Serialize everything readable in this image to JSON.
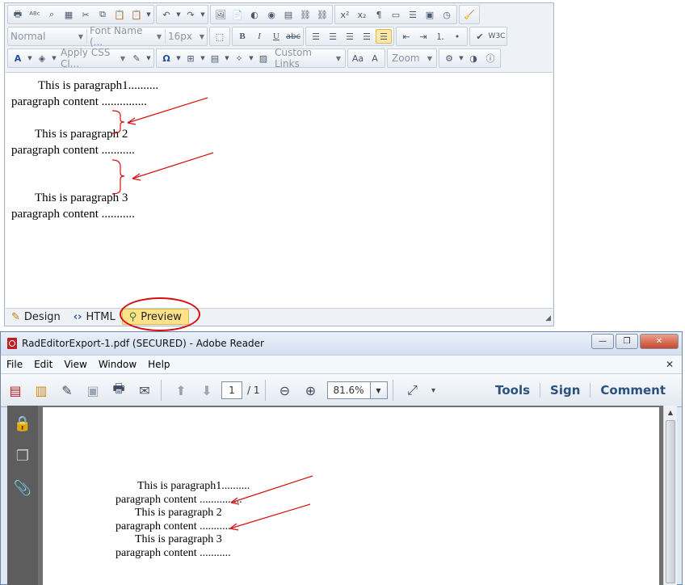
{
  "editor": {
    "toolbar": {
      "format_block": "Normal",
      "font_name": "Font Name (...",
      "font_size": "16px",
      "css_class": "Apply CSS Cl...",
      "custom_links": "Custom Links",
      "zoom": "Zoom"
    },
    "content": {
      "p1_line1": "This is paragraph1..........",
      "p1_line2": "paragraph content ...............",
      "p2_line1": "This is paragraph 2",
      "p2_line2": "paragraph content ...........",
      "p3_line1": "This is paragraph 3",
      "p3_line2": "paragraph content ..........."
    },
    "modes": {
      "design": "Design",
      "html": "HTML",
      "preview": "Preview"
    },
    "colors": {
      "annotation_red": "#d80f0f",
      "active_mode": "#fde28a"
    }
  },
  "reader": {
    "title": "RadEditorExport-1.pdf (SECURED) - Adobe Reader",
    "menu": {
      "file": "File",
      "edit": "Edit",
      "view": "View",
      "window": "Window",
      "help": "Help"
    },
    "page_current": "1",
    "page_total": "/ 1",
    "zoom": "81.6%",
    "links": {
      "tools": "Tools",
      "sign": "Sign",
      "comment": "Comment"
    },
    "doc": {
      "p1_line1": "This is paragraph1..........",
      "p1_line2": "paragraph content ...............",
      "p2_line1": "This is paragraph 2",
      "p2_line2": "paragraph content ...........",
      "p3_line1": "This is paragraph 3",
      "p3_line2": "paragraph content ..........."
    }
  }
}
